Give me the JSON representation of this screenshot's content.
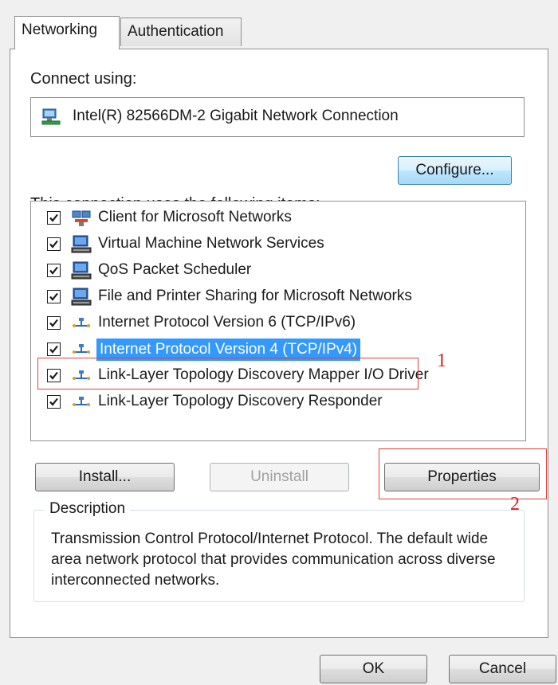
{
  "tabs": [
    {
      "label": "Networking",
      "active": true
    },
    {
      "label": "Authentication",
      "active": false
    }
  ],
  "connect_using": {
    "label": "Connect using:",
    "adapter_name": "Intel(R) 82566DM-2 Gigabit Network Connection",
    "adapter_icon": "network-adapter-icon"
  },
  "configure_button": "Configure...",
  "items_label": "This connection uses the following items:",
  "items": [
    {
      "label": "Client for Microsoft Networks",
      "checked": true,
      "icon": "network-client-icon"
    },
    {
      "label": "Virtual Machine Network Services",
      "checked": true,
      "icon": "computer-service-icon"
    },
    {
      "label": "QoS Packet Scheduler",
      "checked": true,
      "icon": "computer-service-icon"
    },
    {
      "label": "File and Printer Sharing for Microsoft Networks",
      "checked": true,
      "icon": "computer-service-icon"
    },
    {
      "label": "Internet Protocol Version 6 (TCP/IPv6)",
      "checked": true,
      "icon": "protocol-icon"
    },
    {
      "label": "Internet Protocol Version 4 (TCP/IPv4)",
      "checked": true,
      "icon": "protocol-icon",
      "selected": true
    },
    {
      "label": "Link-Layer Topology Discovery Mapper I/O Driver",
      "checked": true,
      "icon": "protocol-icon"
    },
    {
      "label": "Link-Layer Topology Discovery Responder",
      "checked": true,
      "icon": "protocol-icon"
    }
  ],
  "buttons": {
    "install": "Install...",
    "uninstall": "Uninstall",
    "properties": "Properties",
    "ok": "OK",
    "cancel": "Cancel"
  },
  "description": {
    "title": "Description",
    "text": "Transmission Control Protocol/Internet Protocol. The default wide area network protocol that provides communication across diverse interconnected networks."
  },
  "annotations": {
    "step1": "1",
    "step2": "2",
    "color": "#d62020"
  },
  "colors": {
    "selection": "#3399ff",
    "panel": "#ffffff",
    "dialog": "#f0f0f0"
  }
}
